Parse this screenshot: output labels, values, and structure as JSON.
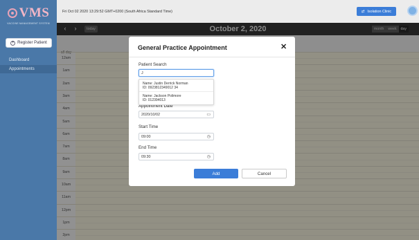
{
  "brand": {
    "logo_text": "VMS",
    "tagline": "VACCINE MANAGEMENT SYSTEM"
  },
  "sidebar": {
    "register_label": "Register Patient",
    "items": [
      {
        "label": "Dashboard",
        "active": false
      },
      {
        "label": "Appointments",
        "active": true
      }
    ]
  },
  "header": {
    "datetime": "Fri Oct 02 2020 13:29:52 GMT+0200 (South Africa Standard Time)",
    "clinic_label": "Isolation Clinic"
  },
  "calendar": {
    "title": "October 2, 2020",
    "today_label": "today",
    "views": [
      {
        "label": "month",
        "active": false
      },
      {
        "label": "week",
        "active": false
      },
      {
        "label": "day",
        "active": true
      }
    ],
    "allday_label": "all-day",
    "hours": [
      "12am",
      "1am",
      "2am",
      "3am",
      "4am",
      "5am",
      "6am",
      "7am",
      "8am",
      "9am",
      "10am",
      "11am",
      "12pm",
      "1pm",
      "2pm"
    ]
  },
  "modal": {
    "title": "General Practice Appointment",
    "patient_search_label": "Patient Search",
    "patient_search_value": "J",
    "suggestions": [
      {
        "name": "Name: Justin Derrick Norman",
        "id": "ID: 0923812349012 34"
      },
      {
        "name": "Name: Jackson Polimore",
        "id": "ID: 012394013"
      }
    ],
    "appointment_date_label": "Appointment Date",
    "appointment_date_value": "2020/10/02",
    "start_time_label": "Start Time",
    "start_time_value": "09:00",
    "end_time_label": "End Time",
    "end_time_value": "09:30",
    "add_label": "Add",
    "cancel_label": "Cancel"
  },
  "colors": {
    "sidebar": "#4a78a8",
    "accent": "#3b7dd8",
    "grid": "#fcf8e3",
    "calbar": "#3a3a3a"
  }
}
